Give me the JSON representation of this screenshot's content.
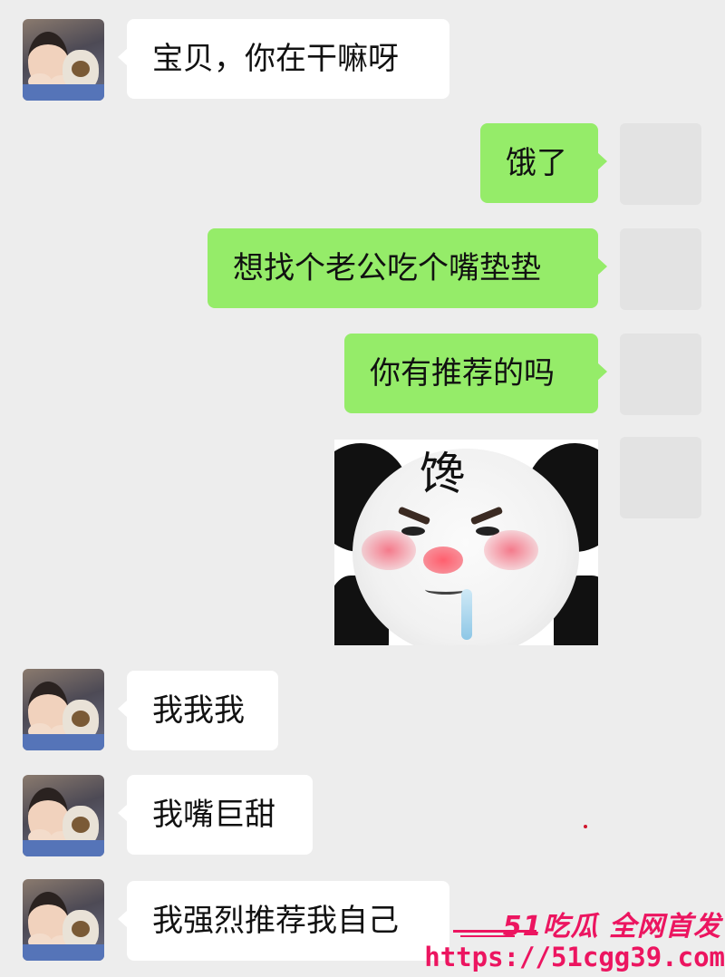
{
  "messages": [
    {
      "side": "in",
      "text": "宝贝，你在干嘛呀"
    },
    {
      "side": "out",
      "text": "饿了"
    },
    {
      "side": "out",
      "text": "想找个老公吃个嘴垫垫"
    },
    {
      "side": "out",
      "text": "你有推荐的吗"
    },
    {
      "side": "out",
      "sticker": "panda-meme",
      "text": "馋"
    },
    {
      "side": "in",
      "text": "我我我"
    },
    {
      "side": "in",
      "text": "我嘴巨甜"
    },
    {
      "side": "in",
      "text": "我强烈推荐我自己"
    }
  ],
  "watermark": {
    "brand": "51吃瓜 全网首发",
    "url": "https://51cgg39.com"
  },
  "colors": {
    "background": "#ededed",
    "incoming_bubble": "#ffffff",
    "outgoing_bubble": "#95ec69",
    "watermark": "#ec1560"
  },
  "icons": {
    "contact_avatar": "child-with-plush-avatar",
    "self_avatar": "blank-avatar"
  }
}
